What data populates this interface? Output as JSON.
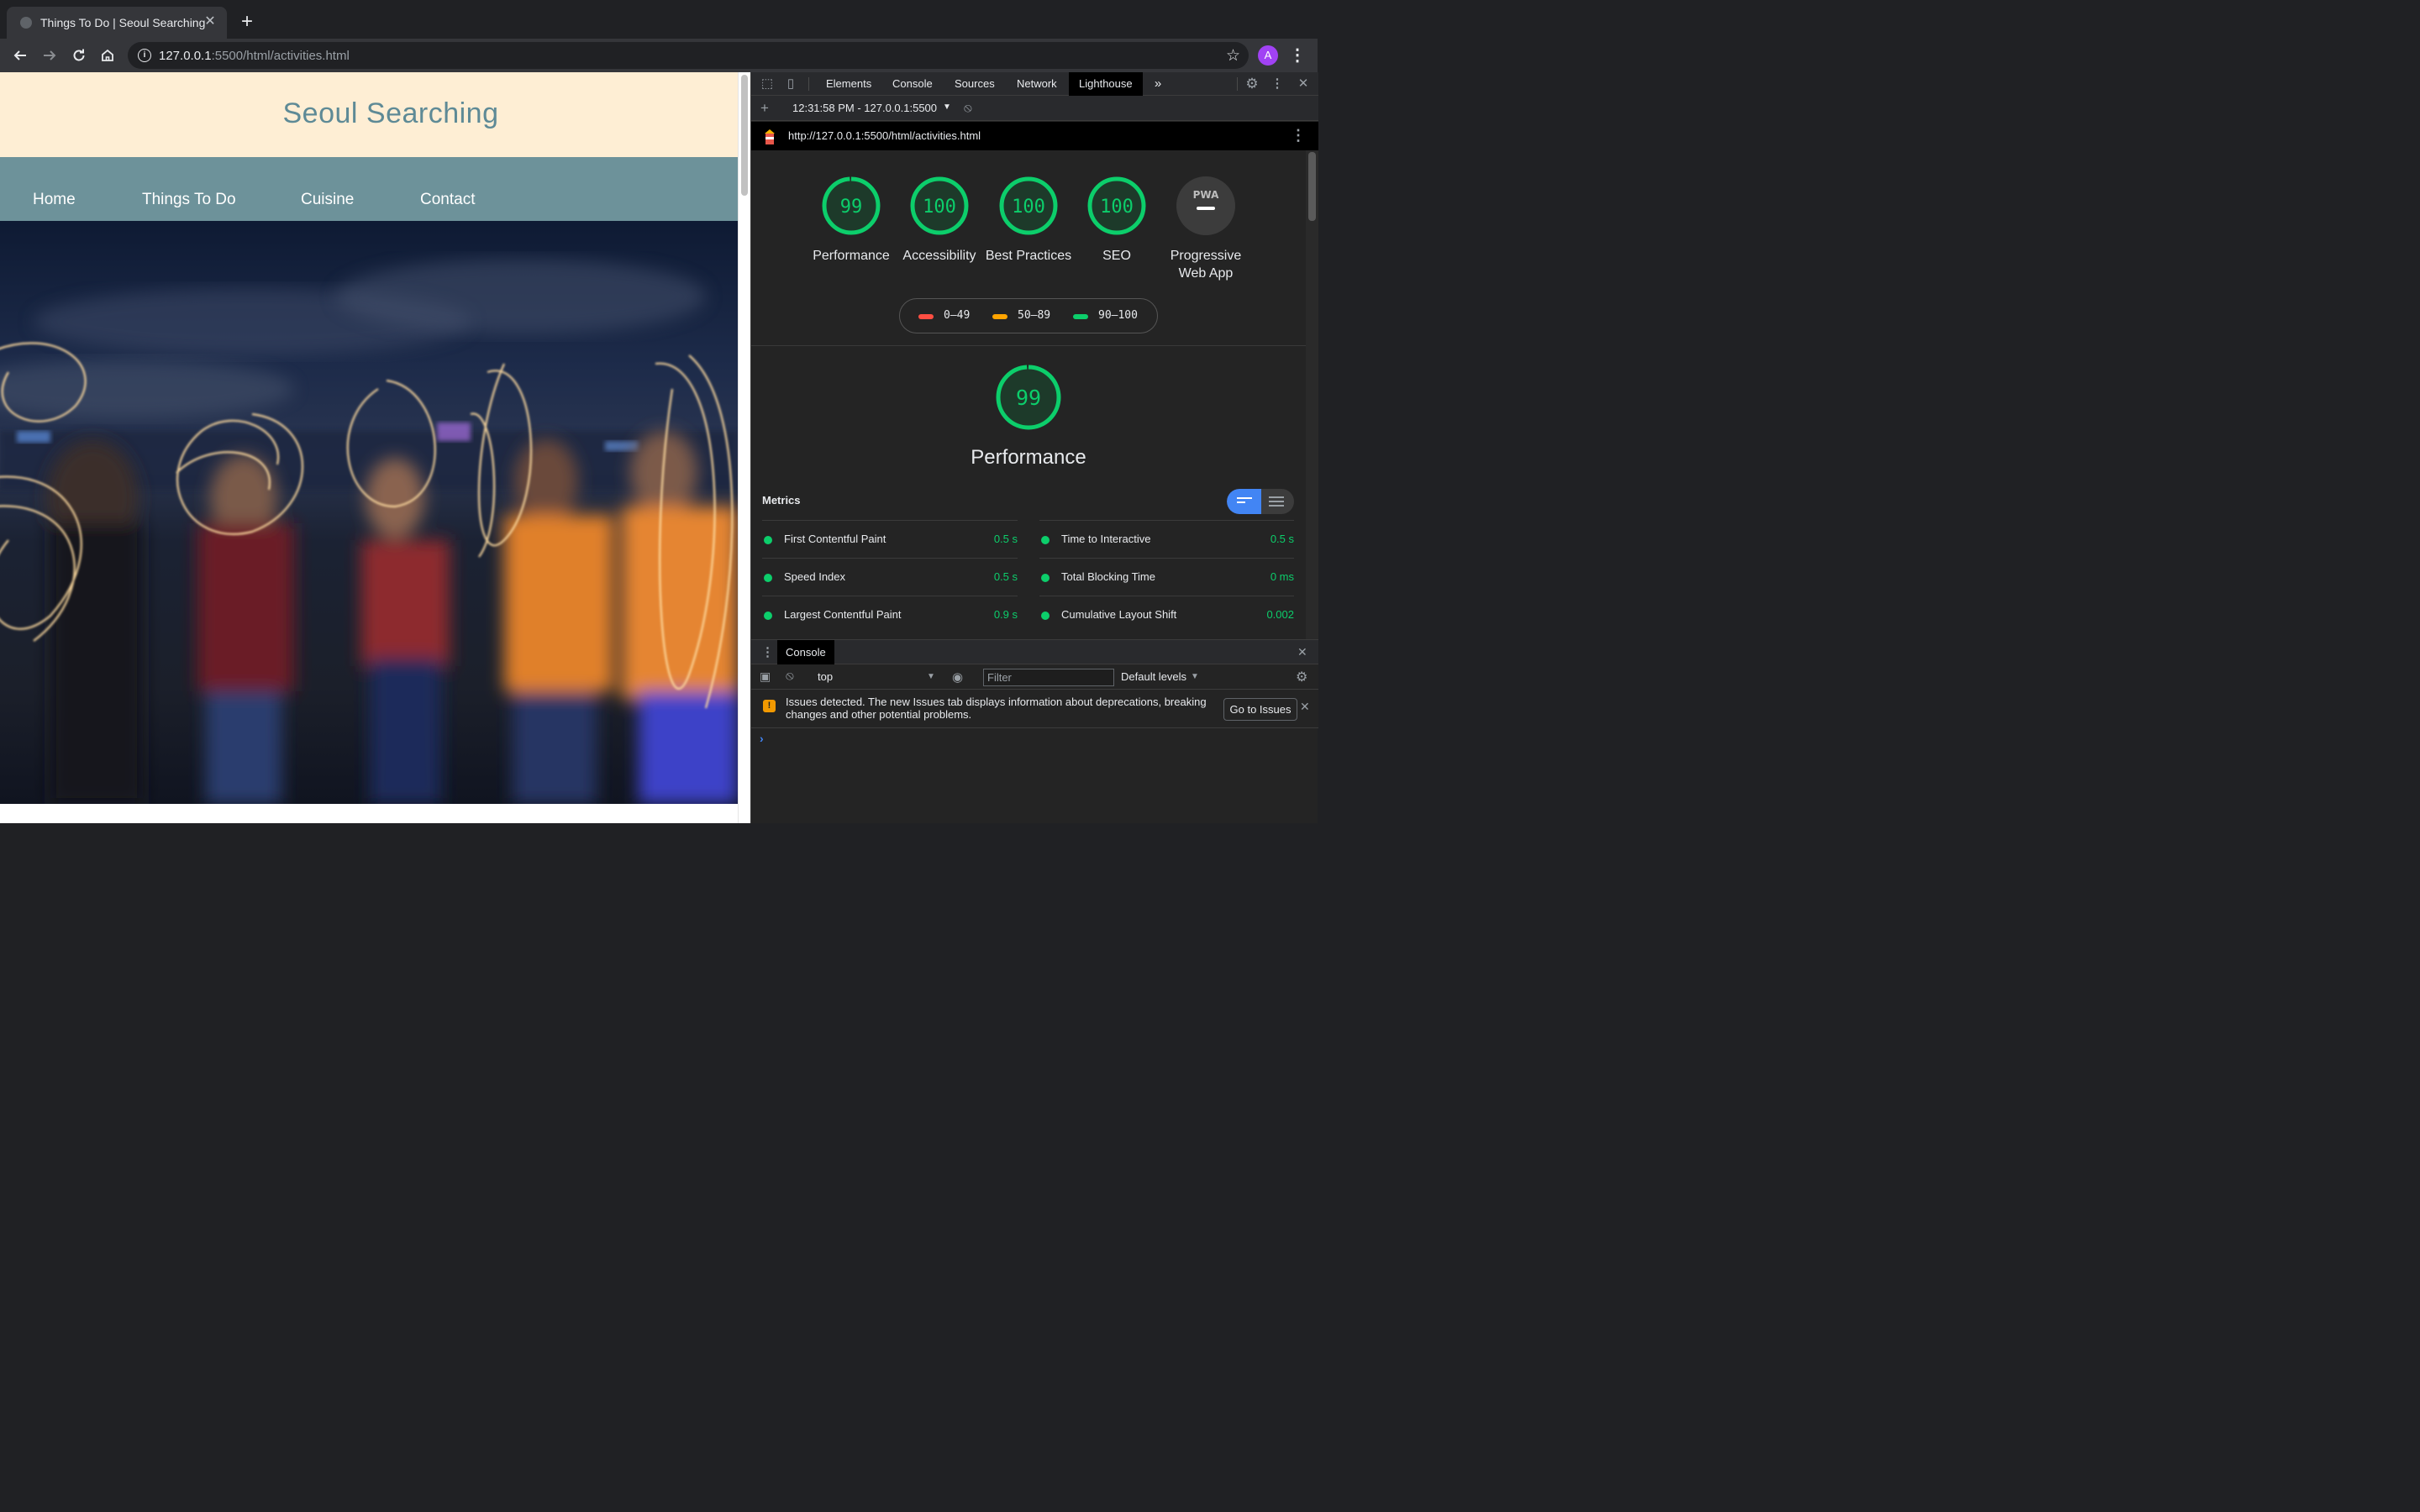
{
  "browser": {
    "tab_title": "Things To Do | Seoul Searching",
    "new_tab_label": "+",
    "url_host": "127.0.0.1",
    "url_rest": ":5500/html/activities.html",
    "profile_initial": "A"
  },
  "site": {
    "title": "Seoul Searching",
    "nav": [
      "Home",
      "Things To Do",
      "Cuisine",
      "Contact"
    ],
    "colors": {
      "header_bg": "#feeed4",
      "nav_bg": "#6d929a",
      "title": "#5e8a96"
    }
  },
  "devtools": {
    "tabs": [
      "Elements",
      "Console",
      "Sources",
      "Network",
      "Lighthouse"
    ],
    "active_tab": "Lighthouse",
    "more_tabs": "»",
    "report_selector": "12:31:58 PM - 127.0.0.1:5500",
    "report_url": "http://127.0.0.1:5500/html/activities.html"
  },
  "lighthouse": {
    "scores": [
      {
        "label": "Performance",
        "value": "99",
        "score": 99
      },
      {
        "label": "Accessibility",
        "value": "100",
        "score": 100
      },
      {
        "label": "Best Practices",
        "value": "100",
        "score": 100
      },
      {
        "label": "SEO",
        "value": "100",
        "score": 100
      },
      {
        "label": "Progressive Web App",
        "value": "PWA",
        "score": null
      }
    ],
    "legend": [
      "0–49",
      "50–89",
      "90–100"
    ],
    "legend_colors": [
      "#ff4e42",
      "#ffa400",
      "#0cce6b"
    ],
    "perf_score": "99",
    "perf_title": "Performance",
    "metrics_title": "Metrics",
    "metrics": [
      {
        "name": "First Contentful Paint",
        "value": "0.5 s"
      },
      {
        "name": "Time to Interactive",
        "value": "0.5 s"
      },
      {
        "name": "Speed Index",
        "value": "0.5 s"
      },
      {
        "name": "Total Blocking Time",
        "value": "0 ms"
      },
      {
        "name": "Largest Contentful Paint",
        "value": "0.9 s"
      },
      {
        "name": "Cumulative Layout Shift",
        "value": "0.002"
      }
    ]
  },
  "console": {
    "tab": "Console",
    "context": "top",
    "filter_placeholder": "Filter",
    "levels": "Default levels",
    "issue_message": "Issues detected. The new Issues tab displays information about deprecations, breaking changes and other potential problems.",
    "go_to_issues": "Go to Issues",
    "prompt": "›"
  }
}
